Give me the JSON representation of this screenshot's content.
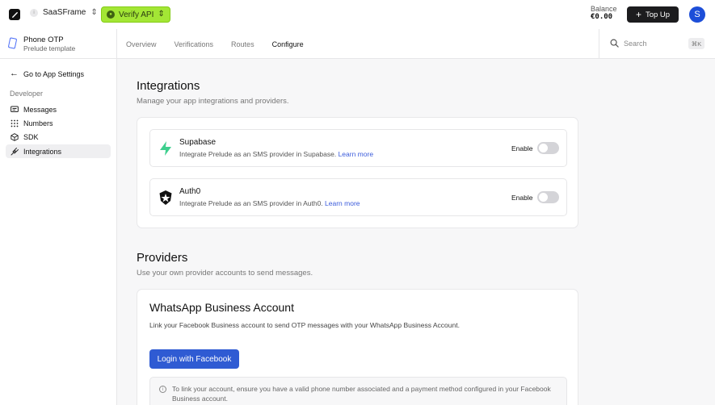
{
  "topbar": {
    "workspace_name": "SaaSFrame",
    "workspace_initial": "i",
    "api_label": "Verify API",
    "balance_label": "Balance",
    "balance_value": "€0.00",
    "topup_label": "Top Up",
    "avatar_initial": "S"
  },
  "project": {
    "name": "Phone OTP",
    "template": "Prelude template"
  },
  "tabs": [
    {
      "label": "Overview"
    },
    {
      "label": "Verifications"
    },
    {
      "label": "Routes"
    },
    {
      "label": "Configure",
      "active": true
    }
  ],
  "search": {
    "placeholder": "Search",
    "shortcut": "⌘K"
  },
  "sidebar": {
    "back_label": "Go to App Settings",
    "section": "Developer",
    "items": [
      {
        "label": "Messages",
        "icon": "message-icon"
      },
      {
        "label": "Numbers",
        "icon": "grid-icon"
      },
      {
        "label": "SDK",
        "icon": "cube-icon"
      },
      {
        "label": "Integrations",
        "icon": "plug-icon",
        "active": true
      }
    ]
  },
  "integrations": {
    "title": "Integrations",
    "subtitle": "Manage your app integrations and providers.",
    "items": [
      {
        "name": "Supabase",
        "description": "Integrate Prelude as an SMS provider in Supabase.",
        "link": "Learn more",
        "toggle_label": "Enable",
        "enabled": false
      },
      {
        "name": "Auth0",
        "description": "Integrate Prelude as an SMS provider in Auth0.",
        "link": "Learn more",
        "toggle_label": "Enable",
        "enabled": false
      }
    ]
  },
  "providers": {
    "title": "Providers",
    "subtitle": "Use your own provider accounts to send messages.",
    "whatsapp": {
      "title": "WhatsApp Business Account",
      "description": "Link your Facebook Business account to send OTP messages with your WhatsApp Business Account.",
      "button_label": "Login with Facebook",
      "note": "To link your account, ensure you have a valid phone number associated and a payment method configured in your Facebook Business account."
    }
  },
  "colors": {
    "accent": "#a3e635",
    "primary_button": "#2f5bd3",
    "link": "#3b5bdb",
    "avatar": "#1d4ed8"
  }
}
